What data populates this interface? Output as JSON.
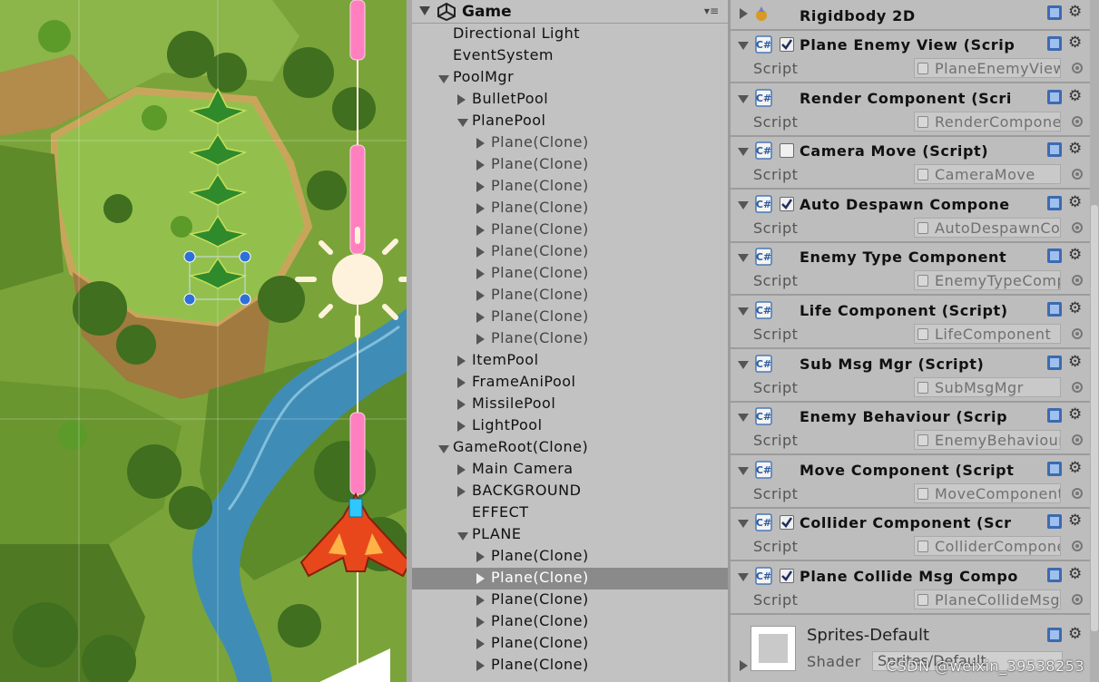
{
  "hierarchy": {
    "title": "Game",
    "menu_icon": "▾≡",
    "rows": [
      {
        "label": "Directional Light",
        "depth": 1,
        "arrow": "none",
        "selected": false
      },
      {
        "label": "EventSystem",
        "depth": 1,
        "arrow": "none",
        "selected": false
      },
      {
        "label": "PoolMgr",
        "depth": 1,
        "arrow": "open",
        "selected": false
      },
      {
        "label": "BulletPool",
        "depth": 2,
        "arrow": "closed",
        "selected": false
      },
      {
        "label": "PlanePool",
        "depth": 2,
        "arrow": "open",
        "selected": false
      },
      {
        "label": "Plane(Clone)",
        "depth": 3,
        "arrow": "closed",
        "selected": false,
        "dim": true
      },
      {
        "label": "Plane(Clone)",
        "depth": 3,
        "arrow": "closed",
        "selected": false,
        "dim": true
      },
      {
        "label": "Plane(Clone)",
        "depth": 3,
        "arrow": "closed",
        "selected": false,
        "dim": true
      },
      {
        "label": "Plane(Clone)",
        "depth": 3,
        "arrow": "closed",
        "selected": false,
        "dim": true
      },
      {
        "label": "Plane(Clone)",
        "depth": 3,
        "arrow": "closed",
        "selected": false,
        "dim": true
      },
      {
        "label": "Plane(Clone)",
        "depth": 3,
        "arrow": "closed",
        "selected": false,
        "dim": true
      },
      {
        "label": "Plane(Clone)",
        "depth": 3,
        "arrow": "closed",
        "selected": false,
        "dim": true
      },
      {
        "label": "Plane(Clone)",
        "depth": 3,
        "arrow": "closed",
        "selected": false,
        "dim": true
      },
      {
        "label": "Plane(Clone)",
        "depth": 3,
        "arrow": "closed",
        "selected": false,
        "dim": true
      },
      {
        "label": "Plane(Clone)",
        "depth": 3,
        "arrow": "closed",
        "selected": false,
        "dim": true
      },
      {
        "label": "ItemPool",
        "depth": 2,
        "arrow": "closed",
        "selected": false
      },
      {
        "label": "FrameAniPool",
        "depth": 2,
        "arrow": "closed",
        "selected": false
      },
      {
        "label": "MissilePool",
        "depth": 2,
        "arrow": "closed",
        "selected": false
      },
      {
        "label": "LightPool",
        "depth": 2,
        "arrow": "closed",
        "selected": false
      },
      {
        "label": "GameRoot(Clone)",
        "depth": 1,
        "arrow": "open",
        "selected": false
      },
      {
        "label": "Main Camera",
        "depth": 2,
        "arrow": "closed",
        "selected": false
      },
      {
        "label": "BACKGROUND",
        "depth": 2,
        "arrow": "closed",
        "selected": false
      },
      {
        "label": "EFFECT",
        "depth": 2,
        "arrow": "none",
        "selected": false
      },
      {
        "label": "PLANE",
        "depth": 2,
        "arrow": "open",
        "selected": false
      },
      {
        "label": "Plane(Clone)",
        "depth": 3,
        "arrow": "closed",
        "selected": false
      },
      {
        "label": "Plane(Clone)",
        "depth": 3,
        "arrow": "closed",
        "selected": true
      },
      {
        "label": "Plane(Clone)",
        "depth": 3,
        "arrow": "closed",
        "selected": false
      },
      {
        "label": "Plane(Clone)",
        "depth": 3,
        "arrow": "closed",
        "selected": false
      },
      {
        "label": "Plane(Clone)",
        "depth": 3,
        "arrow": "closed",
        "selected": false
      },
      {
        "label": "Plane(Clone)",
        "depth": 3,
        "arrow": "closed",
        "selected": false
      }
    ]
  },
  "inspector": {
    "rigidbody": {
      "title": "Rigidbody 2D"
    },
    "components": [
      {
        "title": "Plane Enemy View (Scrip",
        "checkbox": true,
        "checked": true,
        "prop_label": "Script",
        "prop_value": "PlaneEnemyView"
      },
      {
        "title": "Render Component (Scri",
        "checkbox": false,
        "checked": false,
        "prop_label": "Script",
        "prop_value": "RenderComponent"
      },
      {
        "title": "Camera Move (Script)",
        "checkbox": true,
        "checked": false,
        "prop_label": "Script",
        "prop_value": "CameraMove"
      },
      {
        "title": "Auto Despawn Compone",
        "checkbox": true,
        "checked": true,
        "prop_label": "Script",
        "prop_value": "AutoDespawnComponent"
      },
      {
        "title": "Enemy Type Component",
        "checkbox": false,
        "checked": false,
        "prop_label": "Script",
        "prop_value": "EnemyTypeComponent"
      },
      {
        "title": "Life Component (Script)",
        "checkbox": false,
        "checked": false,
        "prop_label": "Script",
        "prop_value": "LifeComponent"
      },
      {
        "title": "Sub Msg Mgr (Script)",
        "checkbox": false,
        "checked": false,
        "prop_label": "Script",
        "prop_value": "SubMsgMgr"
      },
      {
        "title": "Enemy Behaviour (Scrip",
        "checkbox": false,
        "checked": false,
        "prop_label": "Script",
        "prop_value": "EnemyBehaviour"
      },
      {
        "title": "Move Component (Script",
        "checkbox": false,
        "checked": false,
        "prop_label": "Script",
        "prop_value": "MoveComponent"
      },
      {
        "title": "Collider Component (Scr",
        "checkbox": true,
        "checked": true,
        "prop_label": "Script",
        "prop_value": "ColliderComponent"
      },
      {
        "title": "Plane Collide Msg Compo",
        "checkbox": true,
        "checked": true,
        "prop_label": "Script",
        "prop_value": "PlaneCollideMsg"
      }
    ],
    "material": {
      "name": "Sprites-Default",
      "shader_label": "Shader",
      "shader_value": "Sprites/Default"
    }
  },
  "watermark": "CSDN @weixin_39538253"
}
